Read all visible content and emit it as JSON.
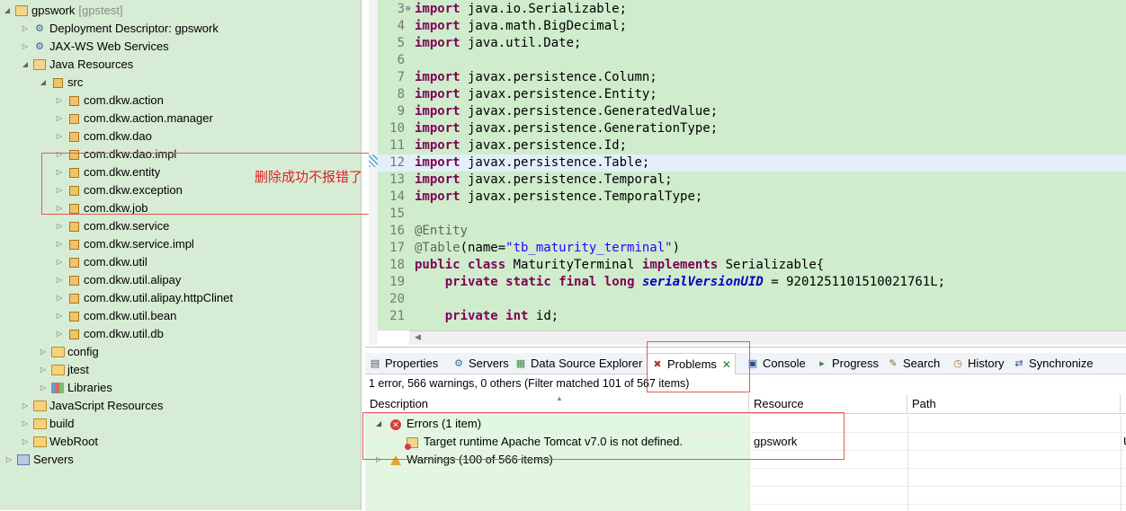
{
  "explorer": {
    "project": {
      "name": "gpswork",
      "suffix": "[gpstest]"
    },
    "items": [
      {
        "label": "Deployment Descriptor: gpswork",
        "icon": "deployment-descriptor-icon"
      },
      {
        "label": "JAX-WS Web Services",
        "icon": "webservice-icon"
      },
      {
        "label": "Java Resources",
        "icon": "java-resources-icon"
      },
      {
        "label": "src",
        "icon": "source-folder-icon"
      },
      {
        "label": "com.dkw.action",
        "icon": "package-icon"
      },
      {
        "label": "com.dkw.action.manager",
        "icon": "package-icon"
      },
      {
        "label": "com.dkw.dao",
        "icon": "package-icon"
      },
      {
        "label": "com.dkw.dao.impl",
        "icon": "package-icon"
      },
      {
        "label": "com.dkw.entity",
        "icon": "package-icon"
      },
      {
        "label": "com.dkw.exception",
        "icon": "package-icon"
      },
      {
        "label": "com.dkw.job",
        "icon": "package-icon"
      },
      {
        "label": "com.dkw.service",
        "icon": "package-icon"
      },
      {
        "label": "com.dkw.service.impl",
        "icon": "package-icon"
      },
      {
        "label": "com.dkw.util",
        "icon": "package-icon"
      },
      {
        "label": "com.dkw.util.alipay",
        "icon": "package-icon"
      },
      {
        "label": "com.dkw.util.alipay.httpClinet",
        "icon": "package-icon"
      },
      {
        "label": "com.dkw.util.bean",
        "icon": "package-icon"
      },
      {
        "label": "com.dkw.util.db",
        "icon": "package-icon"
      },
      {
        "label": "config",
        "icon": "source-folder-icon"
      },
      {
        "label": "jtest",
        "icon": "source-folder-icon"
      },
      {
        "label": "Libraries",
        "icon": "library-icon"
      },
      {
        "label": "JavaScript Resources",
        "icon": "javascript-resources-icon"
      },
      {
        "label": "build",
        "icon": "folder-icon"
      },
      {
        "label": "WebRoot",
        "icon": "folder-icon"
      },
      {
        "label": "Servers",
        "icon": "servers-folder-icon"
      }
    ],
    "annotation_note": "删除成功不报错了"
  },
  "editor": {
    "lines": [
      {
        "n": "3",
        "parts": [
          [
            "kw",
            "import"
          ],
          [
            "t",
            " java.io.Serializable;"
          ]
        ]
      },
      {
        "n": "4",
        "parts": [
          [
            "kw",
            "import"
          ],
          [
            "t",
            " java.math.BigDecimal;"
          ]
        ]
      },
      {
        "n": "5",
        "parts": [
          [
            "kw",
            "import"
          ],
          [
            "t",
            " java.util.Date;"
          ]
        ]
      },
      {
        "n": "6",
        "parts": []
      },
      {
        "n": "7",
        "parts": [
          [
            "kw",
            "import"
          ],
          [
            "t",
            " javax.persistence.Column;"
          ]
        ]
      },
      {
        "n": "8",
        "parts": [
          [
            "kw",
            "import"
          ],
          [
            "t",
            " javax.persistence.Entity;"
          ]
        ]
      },
      {
        "n": "9",
        "parts": [
          [
            "kw",
            "import"
          ],
          [
            "t",
            " javax.persistence.GeneratedValue;"
          ]
        ]
      },
      {
        "n": "10",
        "parts": [
          [
            "kw",
            "import"
          ],
          [
            "t",
            " javax.persistence.GenerationType;"
          ]
        ]
      },
      {
        "n": "11",
        "parts": [
          [
            "kw",
            "import"
          ],
          [
            "t",
            " javax.persistence.Id;"
          ]
        ]
      },
      {
        "n": "12",
        "parts": [
          [
            "kw",
            "import"
          ],
          [
            "t",
            " javax.persistence.Table;"
          ]
        ]
      },
      {
        "n": "13",
        "parts": [
          [
            "kw",
            "import"
          ],
          [
            "t",
            " javax.persistence.Temporal;"
          ]
        ]
      },
      {
        "n": "14",
        "parts": [
          [
            "kw",
            "import"
          ],
          [
            "t",
            " javax.persistence.TemporalType;"
          ]
        ]
      },
      {
        "n": "15",
        "parts": []
      },
      {
        "n": "16",
        "parts": [
          [
            "ann",
            "@Entity"
          ]
        ]
      },
      {
        "n": "17",
        "parts": [
          [
            "ann",
            "@Table"
          ],
          [
            "t",
            "(name="
          ],
          [
            "str",
            "\"tb_maturity_terminal\""
          ],
          [
            "t",
            ")"
          ]
        ]
      },
      {
        "n": "18",
        "parts": [
          [
            "kw",
            "public"
          ],
          [
            "t",
            " "
          ],
          [
            "kw",
            "class"
          ],
          [
            "t",
            " MaturityTerminal "
          ],
          [
            "kw",
            "implements"
          ],
          [
            "t",
            " Serializable{"
          ]
        ]
      },
      {
        "n": "19",
        "parts": [
          [
            "t",
            "    "
          ],
          [
            "kw",
            "private"
          ],
          [
            "t",
            " "
          ],
          [
            "kw",
            "static"
          ],
          [
            "t",
            " "
          ],
          [
            "kw",
            "final"
          ],
          [
            "t",
            " "
          ],
          [
            "kw",
            "long"
          ],
          [
            "t",
            " "
          ],
          [
            "fld",
            "serialVersionUID"
          ],
          [
            "t",
            " = 9201251101510021761L;"
          ]
        ]
      },
      {
        "n": "20",
        "parts": []
      },
      {
        "n": "21",
        "parts": [
          [
            "t",
            "    "
          ],
          [
            "kw",
            "private"
          ],
          [
            "t",
            " "
          ],
          [
            "kw",
            "int"
          ],
          [
            "t",
            " id;"
          ]
        ]
      }
    ]
  },
  "panel": {
    "tabs": [
      {
        "label": "Properties",
        "icon": "properties-icon"
      },
      {
        "label": "Servers",
        "icon": "servers-icon"
      },
      {
        "label": "Data Source Explorer",
        "icon": "data-source-explorer-icon"
      },
      {
        "label": "Problems",
        "icon": "problems-icon",
        "active": true
      },
      {
        "label": "Console",
        "icon": "console-icon"
      },
      {
        "label": "Progress",
        "icon": "progress-icon"
      },
      {
        "label": "Search",
        "icon": "search-icon"
      },
      {
        "label": "History",
        "icon": "history-icon"
      },
      {
        "label": "Synchronize",
        "icon": "synchronize-icon"
      }
    ],
    "close_glyph": "✕",
    "summary": "1 error, 566 warnings, 0 others (Filter matched 101 of 567 items)",
    "columns": [
      "Description",
      "Resource",
      "Path",
      "L"
    ],
    "errors_group": "Errors (1 item)",
    "error_item": {
      "description": "Target runtime Apache Tomcat v7.0 is not defined.",
      "resource": "gpswork",
      "location": "U"
    },
    "warnings_group": "Warnings (100 of 566 items)"
  }
}
